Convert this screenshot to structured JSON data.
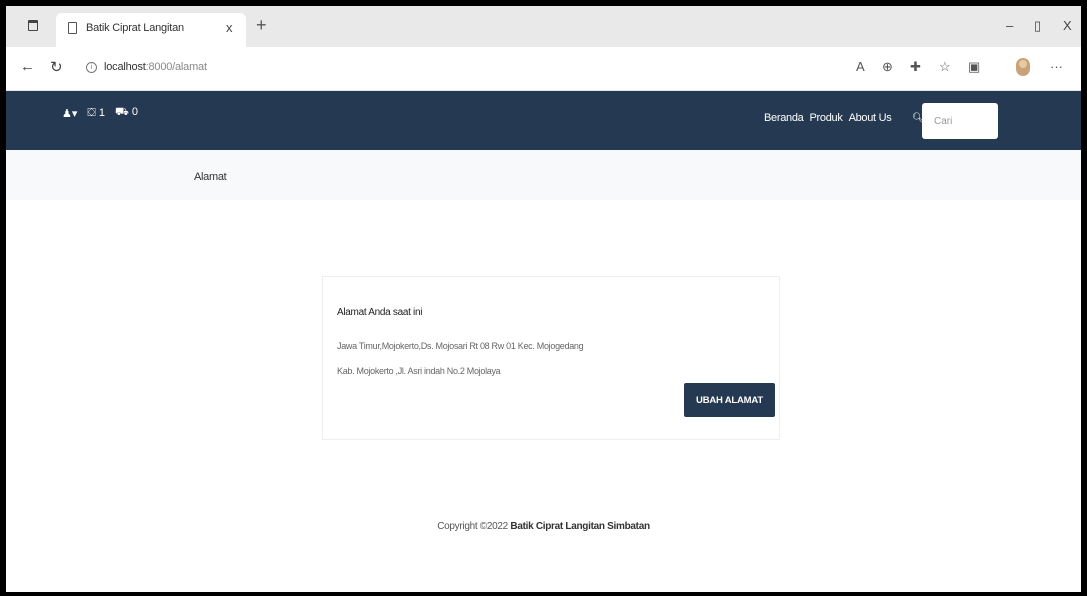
{
  "browser": {
    "tab_title": "Batik Ciprat Langitan",
    "tab_close": "x",
    "new_tab": "+",
    "minimize": "–",
    "maximize": "▯",
    "close": "X",
    "url_host": "localhost",
    "url_path": ":8000/alamat",
    "toolbar_icons": [
      "read-aloud-icon",
      "zoom-icon",
      "favorites-icon",
      "collections-icon",
      "profile-icon",
      "more-icon"
    ]
  },
  "navbar": {
    "user_icon": "♟▾",
    "cart_count": "1",
    "order_count": "0",
    "links": [
      "Beranda",
      "Produk",
      "About Us"
    ],
    "search_placeholder": "Cari",
    "bg_color": "#253a52"
  },
  "breadcrumb": {
    "current": "Alamat"
  },
  "address_card": {
    "heading": "Alamat Anda saat ini",
    "line1": "Jawa Timur,Mojokerto,Ds. Mojosari Rt 08 Rw 01 Kec. Mojogedang",
    "line2": "Kab. Mojokerto ,Jl. Asri indah No.2 Mojolaya",
    "button_label": "UBAH ALAMAT"
  },
  "footer": {
    "prefix": "Copyright ©2022",
    "brand": "Batik Ciprat Langitan Simbatan"
  }
}
